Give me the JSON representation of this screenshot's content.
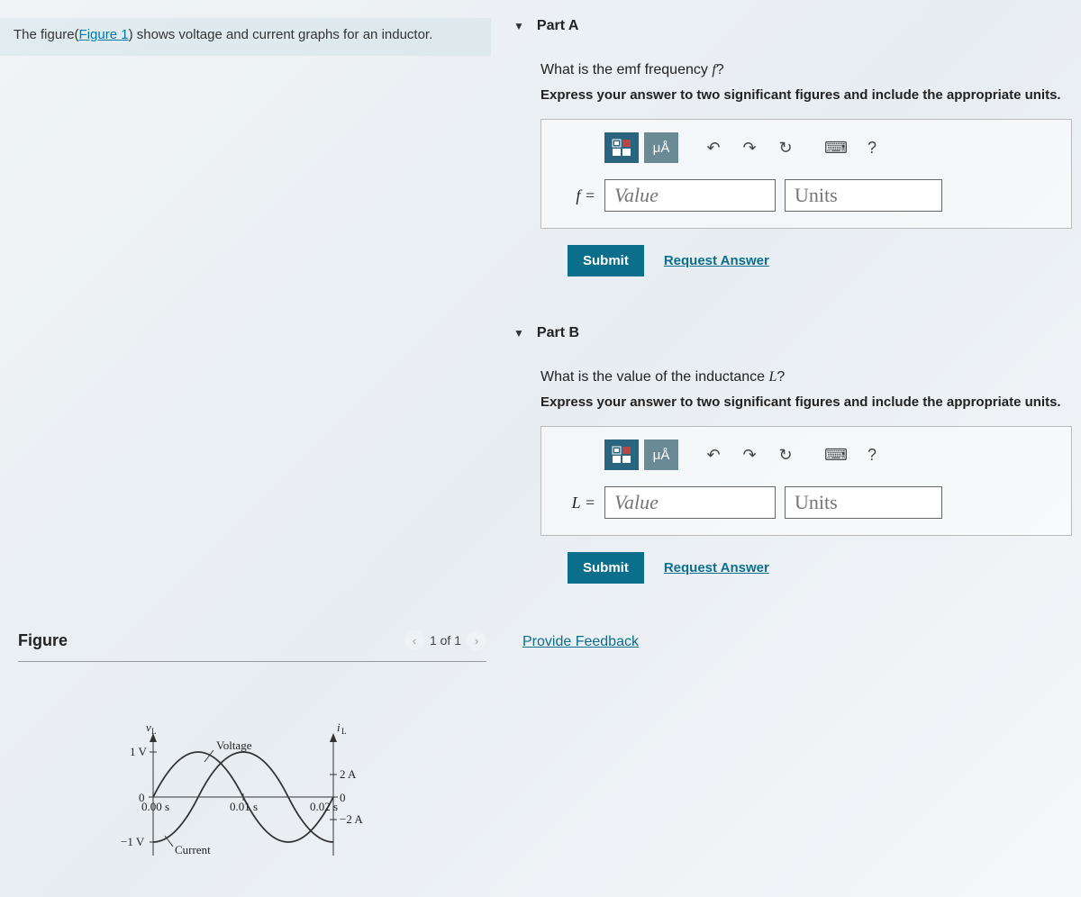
{
  "intro": {
    "prefix": "The figure(",
    "link": "Figure 1",
    "suffix": ") shows voltage and current graphs for an inductor."
  },
  "figure": {
    "title": "Figure",
    "pager": "1 of 1"
  },
  "chart_data": {
    "type": "line",
    "title": "",
    "left_axis_label": "v_L",
    "right_axis_label": "i_L",
    "xlabel": "",
    "x_range": [
      0,
      0.02
    ],
    "x_ticks": [
      "0.00 s",
      "0.01 s",
      "0.02 s"
    ],
    "series": [
      {
        "name": "Voltage",
        "y_amplitude": 1,
        "y_ticks": [
          "1 V",
          "0",
          "−1 V"
        ],
        "phase_deg": 0,
        "description": "sine wave, starts at 0, peak +1V at 0.005s, 0 at 0.01s, trough −1V at 0.015s, 0 at 0.02s"
      },
      {
        "name": "Current",
        "y_amplitude": 2,
        "y_ticks": [
          "2 A",
          "0",
          "−2 A"
        ],
        "phase_deg": -90,
        "description": "−cosine wave, starts at −2A, 0 at 0.005s, +2A at 0.01s, 0 at 0.015s, −2A at 0.02s"
      }
    ]
  },
  "parts": {
    "a": {
      "header": "Part A",
      "question_pre": "What is the emf frequency ",
      "question_var": "f",
      "question_post": "?",
      "instruction": "Express your answer to two significant figures and include the appropriate units.",
      "label": "f =",
      "value_placeholder": "Value",
      "units_placeholder": "Units",
      "submit": "Submit",
      "request": "Request Answer"
    },
    "b": {
      "header": "Part B",
      "question_pre": "What is the value of the inductance ",
      "question_var": "L",
      "question_post": "?",
      "instruction": "Express your answer to two significant figures and include the appropriate units.",
      "label": "L =",
      "value_placeholder": "Value",
      "units_placeholder": "Units",
      "submit": "Submit",
      "request": "Request Answer"
    }
  },
  "toolbar": {
    "units_btn": "μÅ",
    "help": "?"
  },
  "feedback": "Provide Feedback"
}
